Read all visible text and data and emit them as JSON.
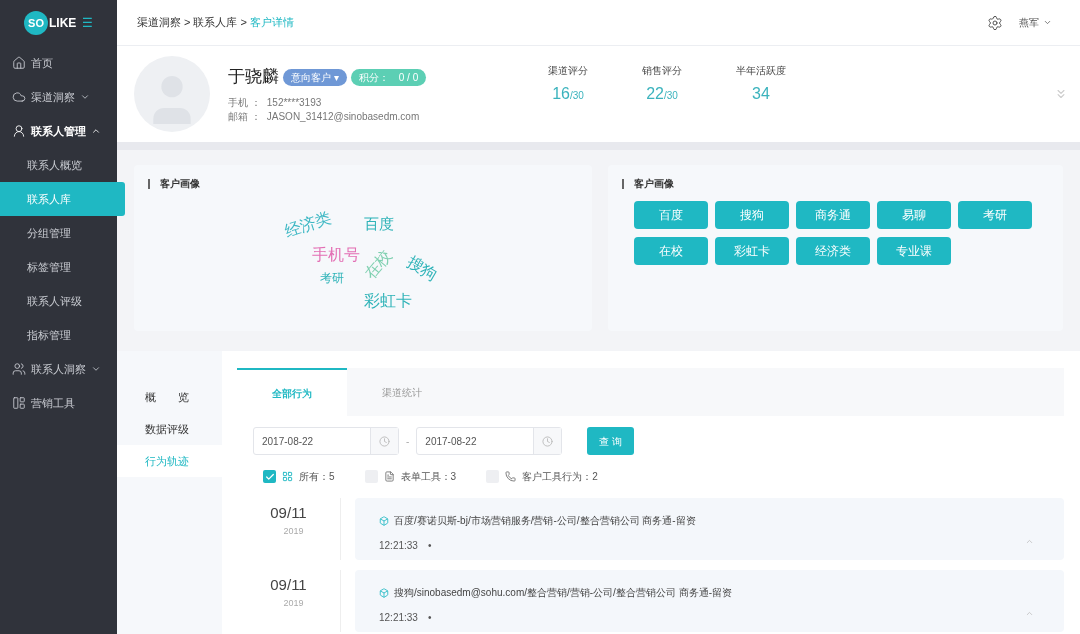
{
  "sidebar": {
    "logo": {
      "badge": "SO",
      "text": "LIKE"
    },
    "menu_icon": "☰",
    "items": [
      {
        "label": "首页"
      },
      {
        "label": "渠道洞察",
        "expanded": false
      },
      {
        "label": "联系人管理",
        "expanded": true,
        "children": [
          {
            "label": "联系人概览",
            "selected": false
          },
          {
            "label": "联系人库",
            "selected": true
          },
          {
            "label": "分组管理",
            "selected": false
          },
          {
            "label": "标签管理",
            "selected": false
          },
          {
            "label": "联系人评级",
            "selected": false
          },
          {
            "label": "指标管理",
            "selected": false
          }
        ]
      },
      {
        "label": "联系人洞察",
        "expanded": false
      },
      {
        "label": "营销工具"
      }
    ]
  },
  "header": {
    "breadcrumb": [
      {
        "label": "渠道洞察",
        "current": false
      },
      {
        "label": "联系人库",
        "current": false
      },
      {
        "label": "客户详情",
        "current": true
      }
    ],
    "separator": ">",
    "user": "燕军"
  },
  "profile": {
    "name": "于骁麟",
    "status_tag": "意向客户",
    "status_caret": "▾",
    "points_label": "积分：",
    "points": "0 / 0",
    "field_separator": "：",
    "phone_label": "手机",
    "phone": "152****3193",
    "email_label": "邮箱",
    "email": "JASON_31412@sinobasedm.com",
    "stats": [
      {
        "label": "渠道评分",
        "value": "16",
        "total": "/30"
      },
      {
        "label": "销售评分",
        "value": "22",
        "total": "/30"
      },
      {
        "label": "半年活跃度",
        "value": "34"
      }
    ]
  },
  "word_cloud": {
    "title": "客户画像",
    "words": [
      {
        "text": "经济类",
        "color": "#3fb8c4"
      },
      {
        "text": "百度",
        "color": "#2fb3b8"
      },
      {
        "text": "手机号",
        "color": "#e36fb4"
      },
      {
        "text": "在校",
        "color": "#7fd0b0"
      },
      {
        "text": "搜狗",
        "color": "#2fb3b8"
      },
      {
        "text": "考研",
        "color": "#2fb3b8"
      },
      {
        "text": "彩虹卡",
        "color": "#2fb3b8"
      }
    ]
  },
  "tags_panel": {
    "title": "客户画像",
    "tags": [
      "百度",
      "搜狗",
      "商务通",
      "易聊",
      "考研",
      "在校",
      "彩虹卡",
      "经济类",
      "专业课"
    ]
  },
  "sub_nav": [
    {
      "label": "概　　览",
      "selected": false
    },
    {
      "label": "数据评级",
      "selected": false
    },
    {
      "label": "行为轨迹",
      "selected": true
    }
  ],
  "tabs": [
    {
      "label": "全部行为",
      "selected": true
    },
    {
      "label": "渠道统计",
      "selected": false
    }
  ],
  "date_range": {
    "start": "2017-08-22",
    "separator": "-",
    "end": "2017-08-22",
    "query_button": "查 询"
  },
  "filters": [
    {
      "label": "所有：5",
      "checked": true
    },
    {
      "label": "表单工具：3",
      "checked": false
    },
    {
      "label": "客户工具行为：2",
      "checked": false
    }
  ],
  "timeline": [
    {
      "date": "09/11",
      "year": "2019",
      "text": "百度/赛诺贝斯-bj/市场营销服务/营销-公司/整合营销公司 商务通-留资",
      "time": "12:21:33",
      "bullet": "•"
    },
    {
      "date": "09/11",
      "year": "2019",
      "text": "搜狗/sinobasedm@sohu.com/整合营销/营销-公司/整合营销公司 商务通-留资",
      "time": "12:21:33",
      "bullet": "•"
    }
  ]
}
